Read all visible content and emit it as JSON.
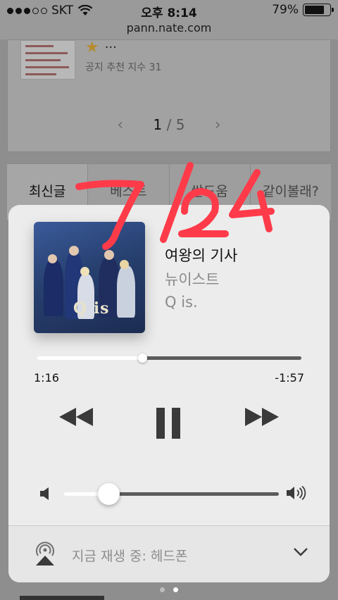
{
  "status_bar": {
    "carrier": "SKT",
    "time": "오후 8:14",
    "battery_percent": "79%",
    "battery_level": 0.79,
    "signal_strength": 3
  },
  "browser": {
    "url": "pann.nate.com"
  },
  "background_page": {
    "post_title_fragment": "···",
    "post_meta": "공지 추천 지수 31",
    "pager": {
      "current": "1",
      "separator": "/",
      "total": "5"
    },
    "tabs": [
      "최신글",
      "베스트",
      "쌀도움",
      "같이볼래?"
    ]
  },
  "handwriting": {
    "text": "7/24",
    "color": "#ff3b4a"
  },
  "now_playing": {
    "song_title": "여왕의 기사",
    "artist": "뉴이스트",
    "album": "Q is.",
    "album_art_logo": "Q is",
    "elapsed": "1:16",
    "remaining": "-1:57",
    "progress": 0.4
  },
  "volume": {
    "level": 0.21
  },
  "audio_output": {
    "label": "지금 재생 중: 헤드폰"
  },
  "control_center_pages": {
    "count": 2,
    "active_index": 1
  },
  "icons": {
    "rewind": "rewind-icon",
    "pause": "pause-icon",
    "forward": "fast-forward-icon",
    "volume_low": "speaker-low-icon",
    "volume_high": "speaker-high-icon",
    "airplay": "airplay-icon",
    "chevron": "chevron-down-icon",
    "wifi": "wifi-icon"
  }
}
